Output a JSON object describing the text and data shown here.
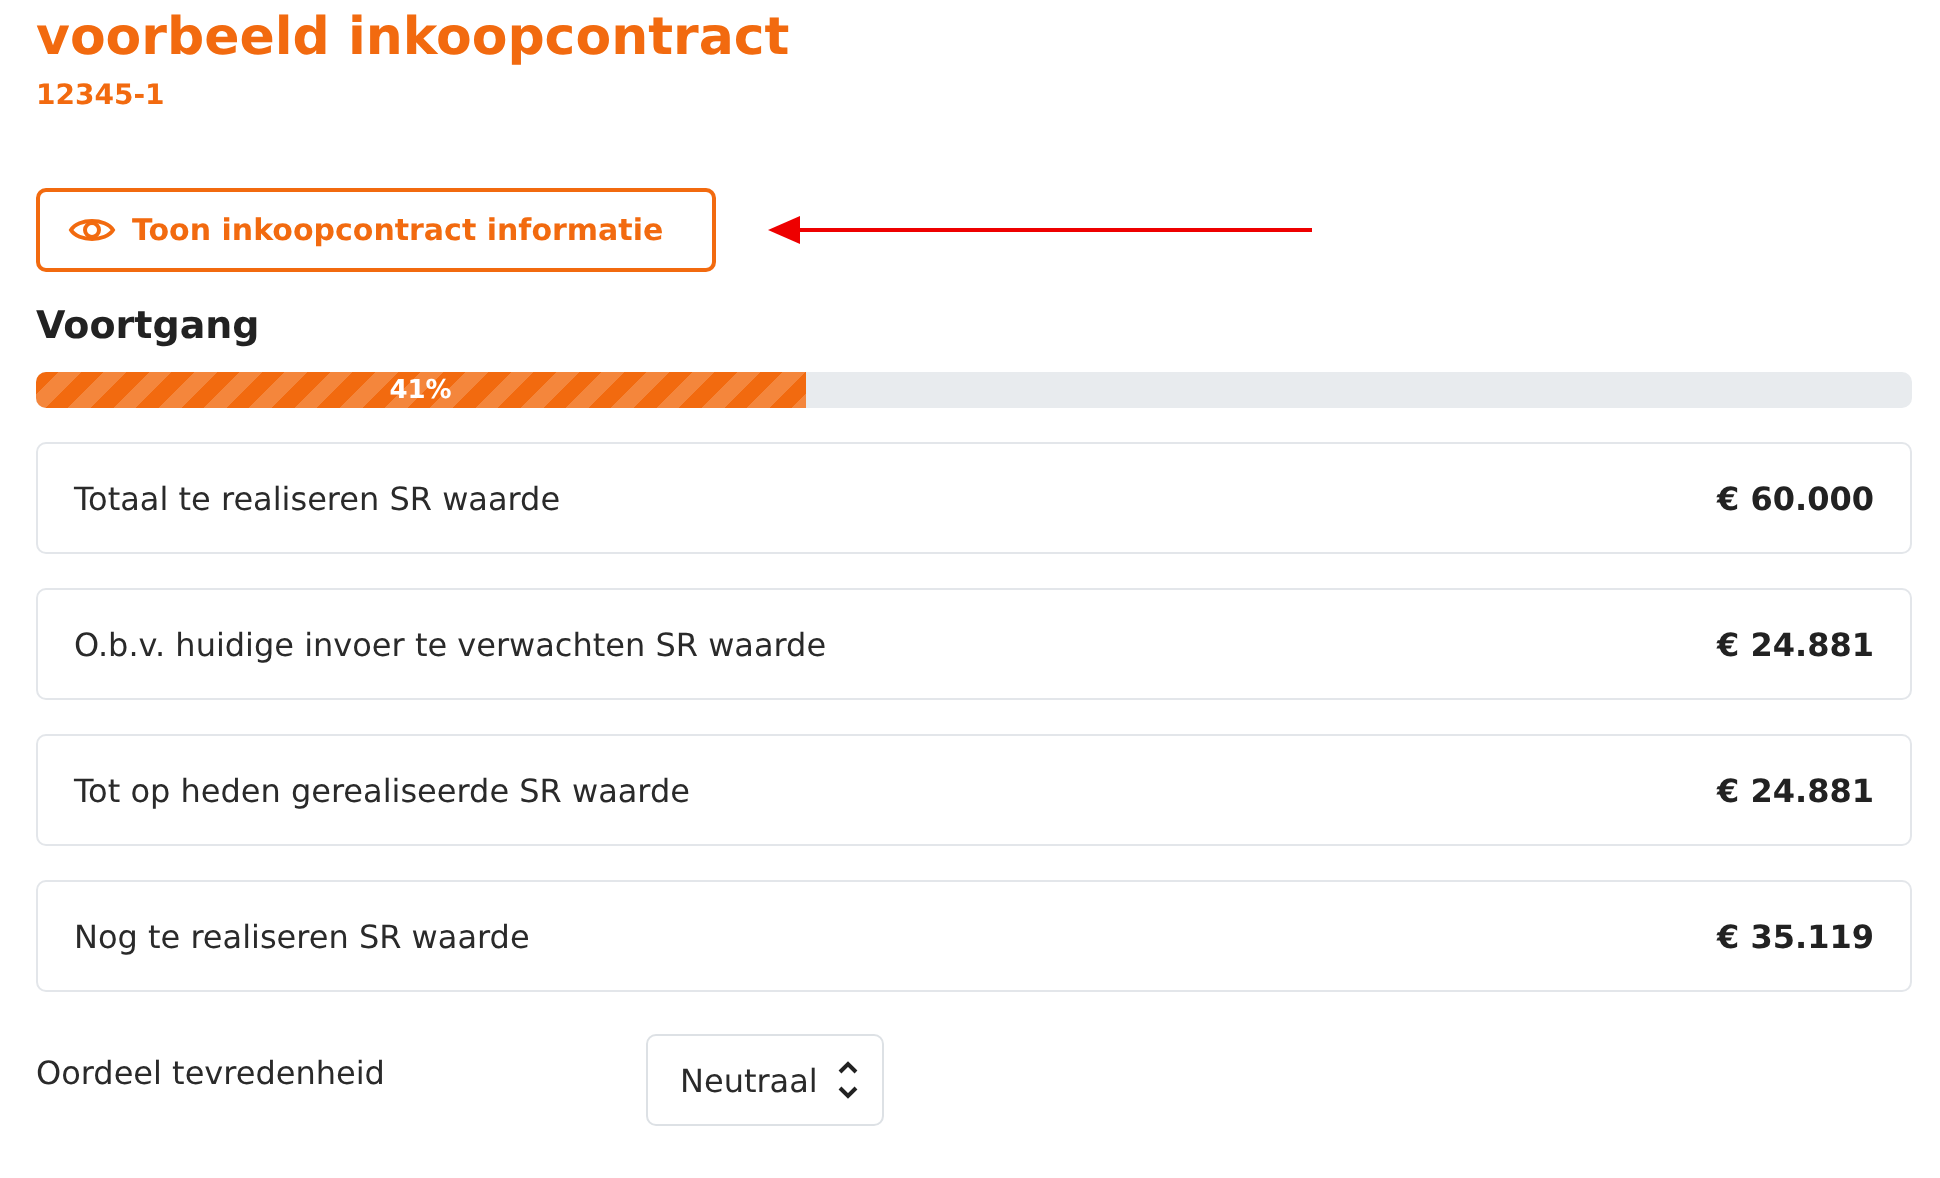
{
  "header": {
    "title": "voorbeeld inkoopcontract",
    "subtitle": "12345-1"
  },
  "info_button": {
    "label": "Toon inkoopcontract informatie"
  },
  "progress": {
    "heading": "Voortgang",
    "level": 0.41,
    "reading": "41%"
  },
  "values": [
    {
      "label": "Totaal te realiseren SR waarde",
      "value": "€ 60.000"
    },
    {
      "label": "O.b.v. huidige invoer te verwachten SR waarde",
      "value": "€ 24.881"
    },
    {
      "label": "Tot op heden gerealiseerde SR waarde",
      "value": "€ 24.881"
    },
    {
      "label": "Nog te realiseren SR waarde",
      "value": "€ 35.119"
    }
  ],
  "satisfaction": {
    "label": "Oordeel tevredenheid",
    "value": "Neutraal"
  }
}
